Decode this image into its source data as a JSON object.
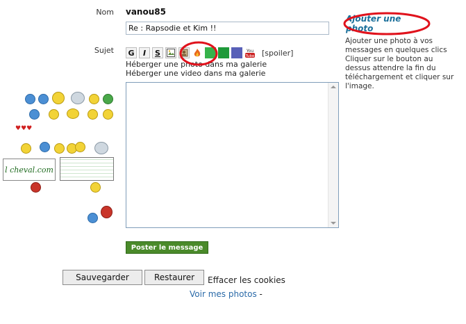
{
  "form": {
    "name_label": "Nom",
    "username": "vanou85",
    "subject_label": "Sujet",
    "subject_value": "Re : Rapsodie et Kim !!",
    "spoiler_label": "[spoiler]",
    "host_photo_text": "Héberger une photo dans ma galerie",
    "host_video_text": "Héberger une video dans ma galerie",
    "post_button": "Poster le message",
    "save_button": "Sauvegarder",
    "restore_button": "Restaurer",
    "clear_cookies": "Effacer les cookies",
    "my_photos_link": "Voir mes photos",
    "my_photos_sep": "-"
  },
  "toolbar": {
    "buttons": [
      "G",
      "I",
      "S"
    ],
    "icons": [
      "image-icon",
      "photo-upload-icon",
      "flame-icon",
      "green-square-icon",
      "green-square-icon",
      "blue-square-icon",
      "youtube-icon"
    ],
    "colors": {
      "green1": "#36b24a",
      "green2": "#1f9a3a",
      "blue": "#5860b8",
      "youtube": "#cc2222"
    }
  },
  "sidebar": {
    "add_photo": "Ajouter une photo",
    "help_text": "Ajouter une photo à vos messages en quelques clics Cliquer sur le bouton au dessus attendre la fin du téléchargement et cliquer sur l'image."
  },
  "smileys": {
    "sign_text": "l cheval.com"
  },
  "annotation_color": "#e0121c",
  "accent_green": "#4a8a2a"
}
